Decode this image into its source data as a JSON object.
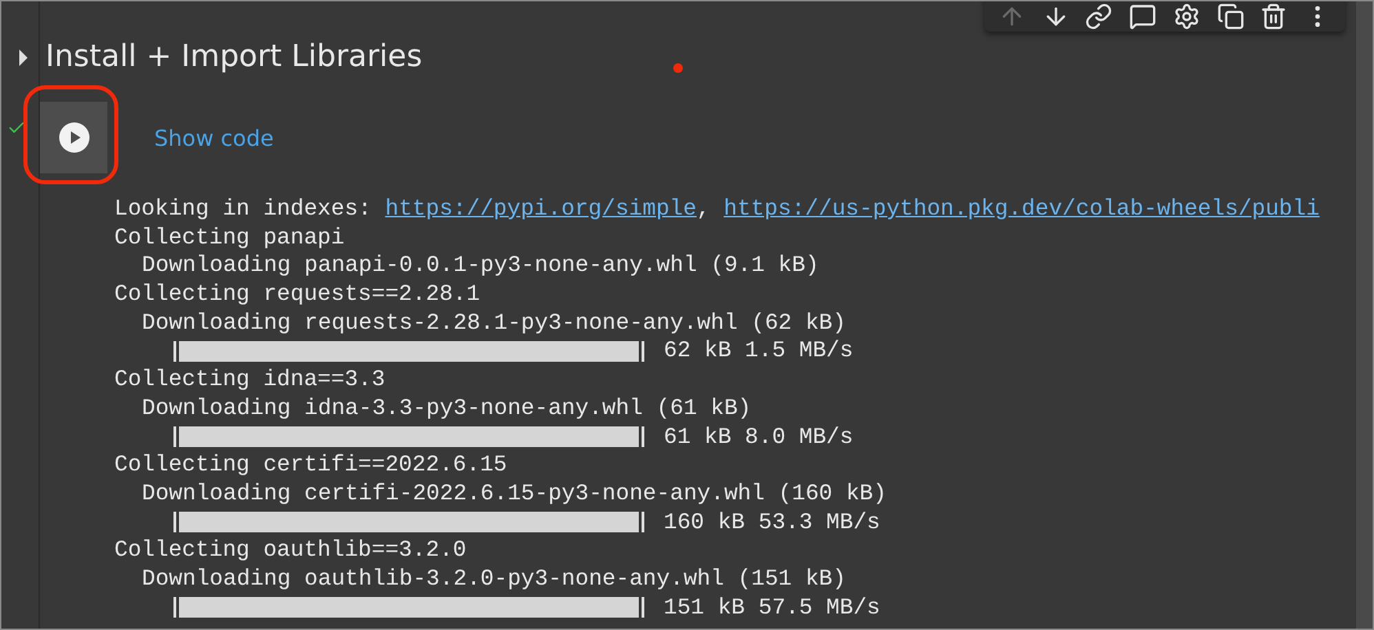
{
  "toolbar": [
    {
      "kind": "up",
      "disabled": true
    },
    {
      "kind": "down",
      "disabled": false
    },
    {
      "kind": "link",
      "disabled": false
    },
    {
      "kind": "comment",
      "disabled": false
    },
    {
      "kind": "settings",
      "disabled": false
    },
    {
      "kind": "mirror",
      "disabled": false
    },
    {
      "kind": "delete",
      "disabled": false
    },
    {
      "kind": "more",
      "disabled": false
    }
  ],
  "section": {
    "title": "Install + Import Libraries",
    "expanded": false
  },
  "cell": {
    "ran": true,
    "show_code": "Show code"
  },
  "output": [
    {
      "kind": "links",
      "prefix": "Looking in indexes: ",
      "separator": ", ",
      "links": [
        "https://pypi.org/simple",
        "https://us-python.pkg.dev/colab-wheels/publi"
      ]
    },
    {
      "kind": "text",
      "text": "Collecting panapi",
      "children": [
        {
          "kind": "text",
          "text": "Downloading panapi-0.0.1-py3-none-any.whl (9.1 kB)"
        }
      ]
    },
    {
      "kind": "text",
      "text": "Collecting requests==2.28.1",
      "children": [
        {
          "kind": "text",
          "text": "Downloading requests-2.28.1-py3-none-any.whl (62 kB)",
          "children": [
            {
              "kind": "progress",
              "level": 1,
              "reading": "62 kB 1.5 MB/s"
            }
          ]
        }
      ]
    },
    {
      "kind": "text",
      "text": "Collecting idna==3.3",
      "children": [
        {
          "kind": "text",
          "text": "Downloading idna-3.3-py3-none-any.whl (61 kB)",
          "children": [
            {
              "kind": "progress",
              "level": 1,
              "reading": "61 kB 8.0 MB/s"
            }
          ]
        }
      ]
    },
    {
      "kind": "text",
      "text": "Collecting certifi==2022.6.15",
      "children": [
        {
          "kind": "text",
          "text": "Downloading certifi-2022.6.15-py3-none-any.whl (160 kB)",
          "children": [
            {
              "kind": "progress",
              "level": 1,
              "reading": "160 kB 53.3 MB/s"
            }
          ]
        }
      ]
    },
    {
      "kind": "text",
      "text": "Collecting oauthlib==3.2.0",
      "children": [
        {
          "kind": "text",
          "text": "Downloading oauthlib-3.2.0-py3-none-any.whl (151 kB)",
          "children": [
            {
              "kind": "progress",
              "level": 1,
              "reading": "151 kB 57.5 MB/s"
            }
          ]
        }
      ]
    }
  ]
}
